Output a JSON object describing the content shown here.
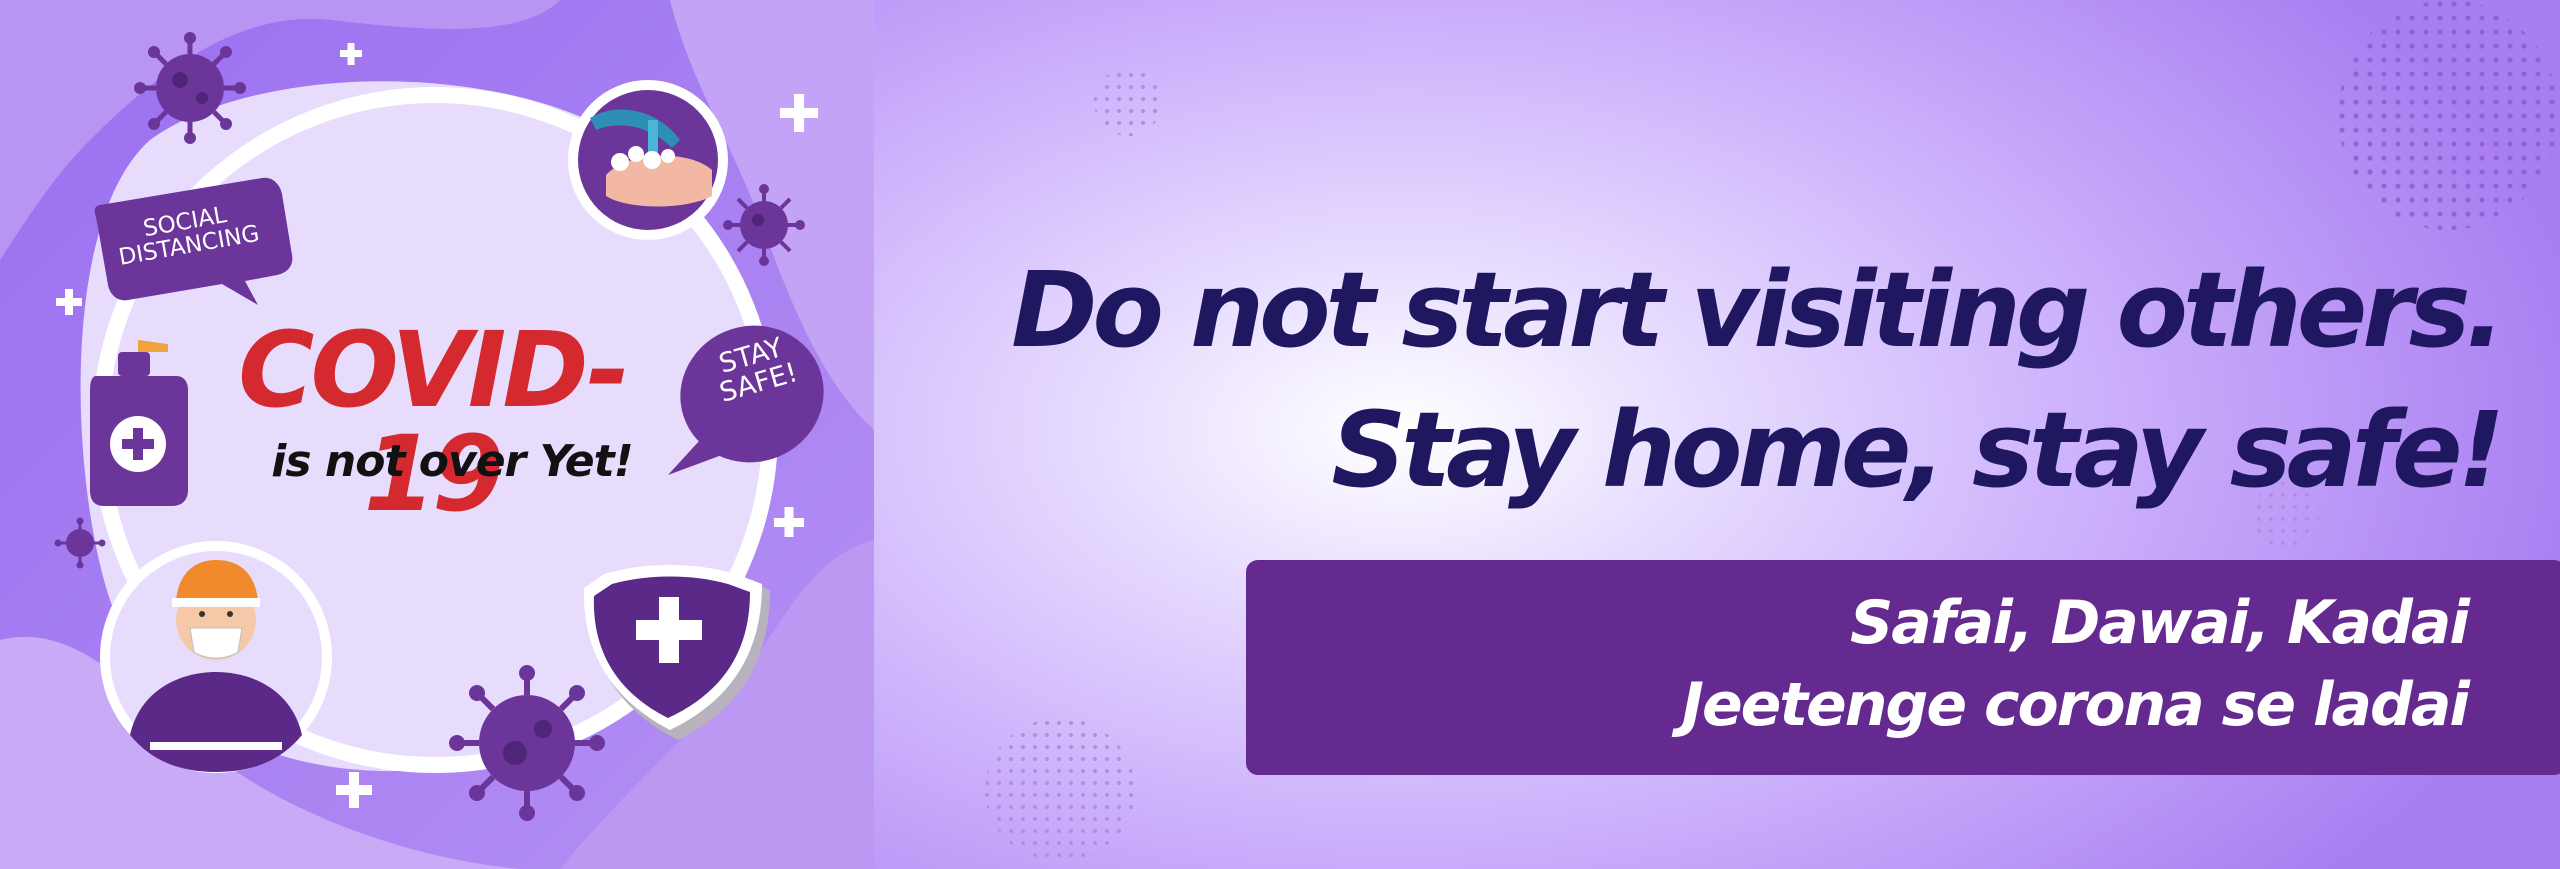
{
  "left": {
    "social_label_1": "SOCIAL",
    "social_label_2": "DISTANCING",
    "stay_label_1": "STAY",
    "stay_label_2": "SAFE!",
    "covid_title": "COVID-19",
    "covid_sub": "is not over Yet!"
  },
  "headline": {
    "line1": "Do not start visiting others.",
    "line2": "Stay home, stay safe!"
  },
  "slogan": {
    "line1": "Safai, Dawai, Kadai",
    "line2": "Jeetenge corona se ladai"
  },
  "colors": {
    "headline": "#1f1860",
    "covid_red": "#d42a2f",
    "purple_dark": "#642a8f",
    "purple_mid": "#7a4bc4",
    "lavender": "#d9c6fb"
  },
  "icons": [
    "virus-icon",
    "plus-icon",
    "handwash-icon",
    "sanitizer-icon",
    "worker-mask-icon",
    "shield-plus-icon",
    "dot-pattern"
  ]
}
